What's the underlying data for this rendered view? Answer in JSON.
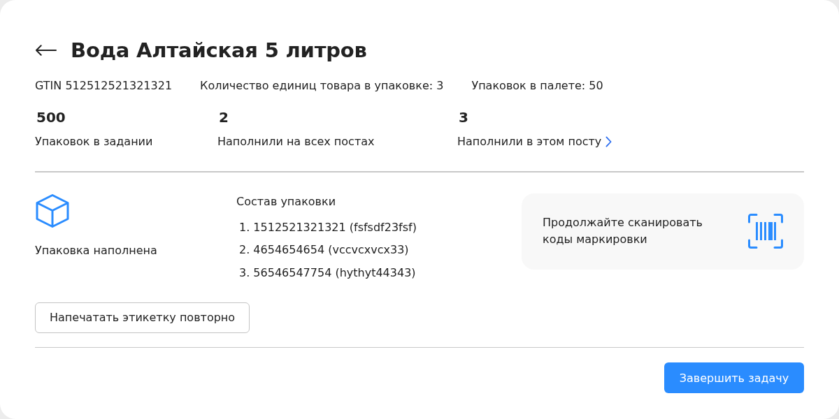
{
  "header": {
    "title": "Вода Алтайская 5 литров"
  },
  "info": [
    "GTIN 512512521321321",
    "Количество единиц товара в упаковке: 3",
    "Упаковок в палете: 50"
  ],
  "stats": [
    {
      "kind": "text",
      "value": "500",
      "label": "Упаковок в задании"
    },
    {
      "kind": "text",
      "value": "2",
      "label": "Наполнили на всех постах"
    },
    {
      "kind": "link",
      "value": "3",
      "label": "Наполнили в этом посту"
    }
  ],
  "package": {
    "status": "Упаковка наполнена",
    "print_button": "Напечатать этикетку повторно"
  },
  "composition": {
    "title": "Состав упаковки",
    "items": [
      "1. 1512521321321 (fsfsdf23fsf)",
      "2. 4654654654 (vccvcxvcx33)",
      "3. 56546547754 (hythyt44343)"
    ]
  },
  "scan_hint": {
    "text": "Продолжайте сканировать коды маркировки"
  },
  "finish_button": "Завершить задачу"
}
